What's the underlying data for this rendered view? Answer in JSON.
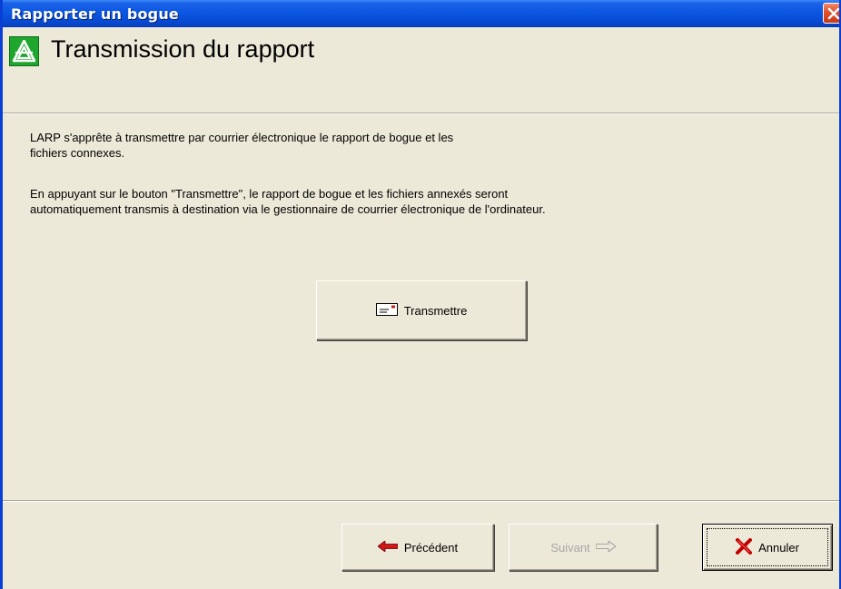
{
  "window": {
    "title": "Rapporter un bogue"
  },
  "header": {
    "title": "Transmission du rapport",
    "logo_icon": "larp-logo-icon"
  },
  "content": {
    "paragraph1_line1": "LARP s'apprête à transmettre par courrier électronique le rapport de bogue et les",
    "paragraph1_line2": "fichiers connexes.",
    "paragraph2_line1": "En appuyant sur le bouton \"Transmettre\", le rapport de bogue et les fichiers annexés seront",
    "paragraph2_line2": "automatiquement transmis à destination via le gestionnaire de courrier électronique de l'ordinateur."
  },
  "buttons": {
    "send_label": "Transmettre",
    "send_icon": "envelope-icon",
    "prev_label": "Précédent",
    "prev_icon": "arrow-left-icon",
    "next_label": "Suivant",
    "next_icon": "arrow-right-icon",
    "cancel_label": "Annuler",
    "cancel_icon": "red-x-icon"
  },
  "colors": {
    "titlebar": "#0a55e0",
    "dialog_bg": "#ece9d8",
    "logo_green": "#1ea62e",
    "disabled_text": "#a7a6aa"
  }
}
